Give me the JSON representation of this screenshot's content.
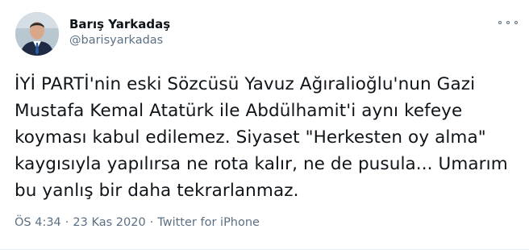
{
  "tweet": {
    "author_name": "Barış Yarkadaş",
    "author_handle": "@barisyarkadas",
    "text": "İYİ PARTİ'nin eski Sözcüsü Yavuz Ağıralioğlu'nun Gazi\nMustafa Kemal Atatürk ile Abdülhamit'i aynı kefeye\nkoyması kabul edilemez. Siyaset \"Herkesten oy alma\"\nkaygısıyla yapılırsa ne rota kalır, ne de pusula... Umarım\nbu yanlış bir daha tekrarlanmaz.",
    "time": "ÖS 4:34",
    "separator": "·",
    "date": "23 Kas 2020",
    "source": "Twitter for iPhone"
  },
  "icons": {
    "avatar": "profile-photo",
    "more": "more-options-icon"
  }
}
